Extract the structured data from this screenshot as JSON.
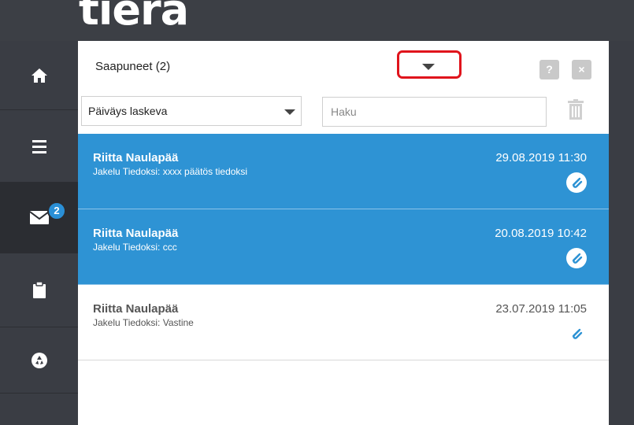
{
  "app": {
    "logo_text": "tiera"
  },
  "sidebar": {
    "items": [
      {
        "name": "home",
        "icon": "home-icon"
      },
      {
        "name": "menu",
        "icon": "menu-icon"
      },
      {
        "name": "messages",
        "icon": "mail-icon",
        "badge": "2"
      },
      {
        "name": "clipboard",
        "icon": "clipboard-icon"
      },
      {
        "name": "recycle",
        "icon": "recycle-icon"
      }
    ]
  },
  "panel": {
    "title": "Saapuneet (2)",
    "help_label": "?",
    "close_label": "×"
  },
  "filters": {
    "sort_value": "Päiväys laskeva",
    "search_placeholder": "Haku"
  },
  "messages": [
    {
      "sender": "Riitta Naulapää",
      "subject": "Jakelu Tiedoksi: xxxx päätös tiedoksi",
      "date": "29.08.2019 11:30",
      "selected": true
    },
    {
      "sender": "Riitta Naulapää",
      "subject": "Jakelu Tiedoksi: ccc",
      "date": "20.08.2019 10:42",
      "selected": true
    },
    {
      "sender": "Riitta Naulapää",
      "subject": "Jakelu Tiedoksi: Vastine",
      "date": "23.07.2019 11:05",
      "selected": false
    }
  ],
  "colors": {
    "accent": "#2e93d4",
    "sidebar": "#3a3d44",
    "highlight_border": "#e0141c"
  }
}
